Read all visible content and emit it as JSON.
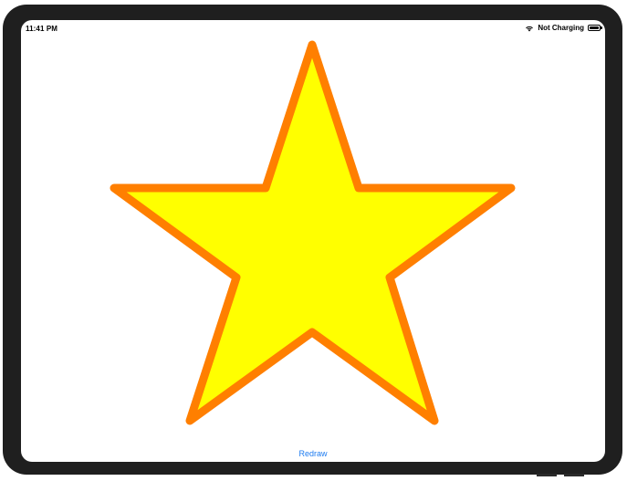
{
  "status_bar": {
    "time": "11:41 PM",
    "charging_text": "Not Charging",
    "icons": [
      "wifi-icon",
      "battery-icon"
    ]
  },
  "canvas": {
    "shape": "star",
    "fill_color": "#ffff00",
    "stroke_color": "#ff7f00"
  },
  "redraw_button": {
    "label": "Redraw",
    "color": "#1e7cf0"
  }
}
